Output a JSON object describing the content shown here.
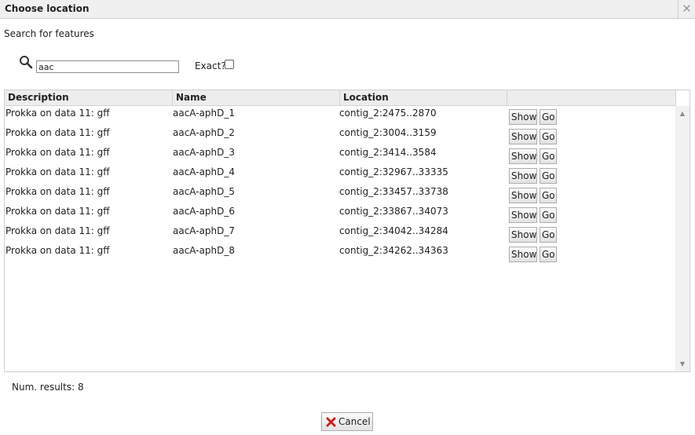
{
  "dialog": {
    "title": "Choose location",
    "close_glyph": "✕"
  },
  "search": {
    "section_label": "Search for features",
    "value": "aac",
    "icon": "search-icon",
    "exact_label": "Exact?",
    "exact_checked": false
  },
  "grid": {
    "columns": [
      "Description",
      "Name",
      "Location"
    ],
    "rows": [
      {
        "description": "Prokka on data 11: gff",
        "name": "aacA-aphD_1",
        "location": "contig_2:2475..2870",
        "show": "Show",
        "go": "Go"
      },
      {
        "description": "Prokka on data 11: gff",
        "name": "aacA-aphD_2",
        "location": "contig_2:3004..3159",
        "show": "Show",
        "go": "Go"
      },
      {
        "description": "Prokka on data 11: gff",
        "name": "aacA-aphD_3",
        "location": "contig_2:3414..3584",
        "show": "Show",
        "go": "Go"
      },
      {
        "description": "Prokka on data 11: gff",
        "name": "aacA-aphD_4",
        "location": "contig_2:32967..33335",
        "show": "Show",
        "go": "Go"
      },
      {
        "description": "Prokka on data 11: gff",
        "name": "aacA-aphD_5",
        "location": "contig_2:33457..33738",
        "show": "Show",
        "go": "Go"
      },
      {
        "description": "Prokka on data 11: gff",
        "name": "aacA-aphD_6",
        "location": "contig_2:33867..34073",
        "show": "Show",
        "go": "Go"
      },
      {
        "description": "Prokka on data 11: gff",
        "name": "aacA-aphD_7",
        "location": "contig_2:34042..34284",
        "show": "Show",
        "go": "Go"
      },
      {
        "description": "Prokka on data 11: gff",
        "name": "aacA-aphD_8",
        "location": "contig_2:34262..34363",
        "show": "Show",
        "go": "Go"
      }
    ]
  },
  "footer": {
    "num_results": "Num. results: 8",
    "cancel_label": "Cancel"
  },
  "colors": {
    "cancel_icon": "#cc2020",
    "header_bg": "#ededed"
  }
}
